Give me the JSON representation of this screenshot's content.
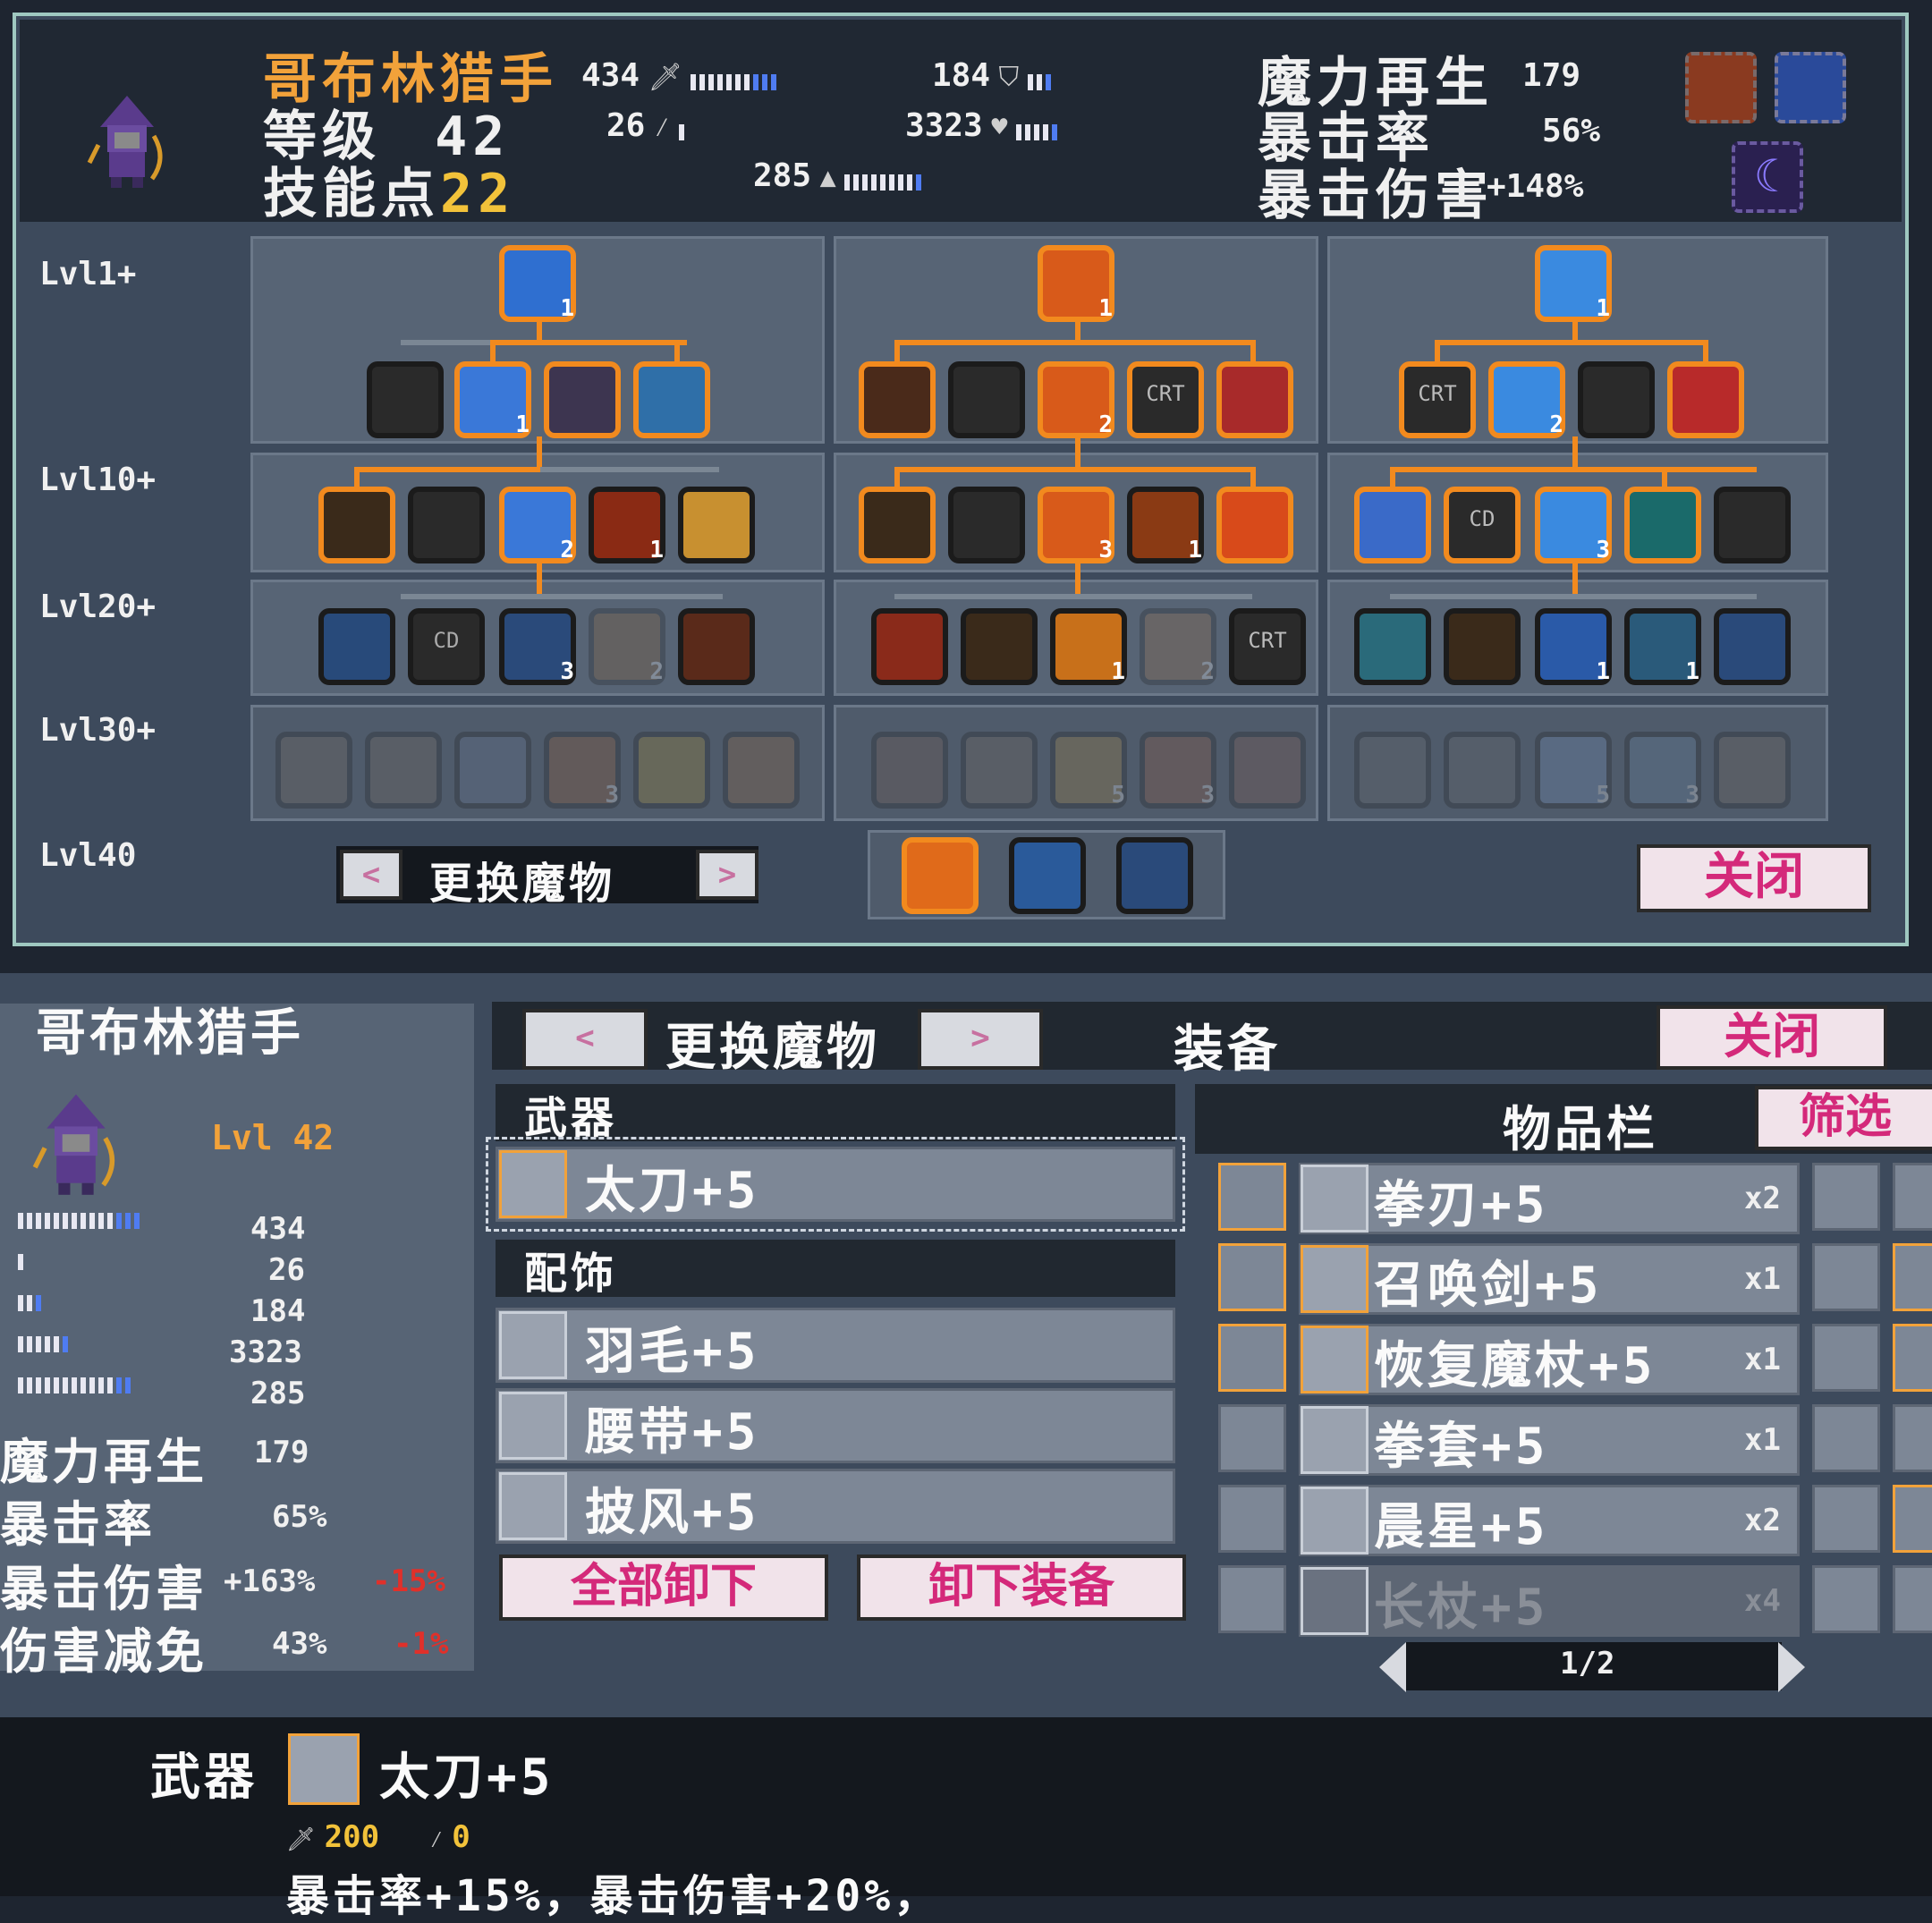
{
  "header": {
    "character_name": "哥布林猎手",
    "level_label": "等级",
    "level_value": "42",
    "skill_points_label": "技能点",
    "skill_points_value": "22",
    "attack": "434",
    "magic": "26",
    "defense": "184",
    "hp": "3323",
    "speed": "285",
    "mana_regen_label": "魔力再生",
    "mana_regen_value": "179",
    "crit_rate_label": "暴击率",
    "crit_rate_value": "56%",
    "crit_dmg_label": "暴击伤害",
    "crit_dmg_value": "+148%"
  },
  "skill_tree": {
    "level_labels": [
      "Lvl1+",
      "Lvl10+",
      "Lvl20+",
      "Lvl30+",
      "Lvl40"
    ],
    "node_counts": {
      "t1_top": "1",
      "t1_r2": "1",
      "t1_r3": "2",
      "t1_r3b": "1",
      "t1_r4a": "3",
      "t1_r4b": "2",
      "t1_r5": "3",
      "t2_top": "1",
      "t2_r2": "2",
      "t2_r3": "3",
      "t2_r3b": "1",
      "t2_r4": "1",
      "t2_r4b": "2",
      "t2_r5a": "5",
      "t2_r5b": "3",
      "t3_top": "1",
      "t3_r2": "2",
      "t3_r3": "3",
      "t3_r4a": "1",
      "t3_r4b": "1",
      "t3_r5a": "5",
      "t3_r5b": "3"
    },
    "crt_label": "CRT",
    "cd_label": "CD",
    "change_monster": "更换魔物",
    "prev_arrow": "<",
    "next_arrow": ">",
    "close": "关闭"
  },
  "equipment": {
    "character_name": "哥布林猎手",
    "level": "Lvl 42",
    "stats": [
      "434",
      "26",
      "184",
      "3323",
      "285"
    ],
    "mana_regen_label": "魔力再生",
    "mana_regen_value": "179",
    "crit_rate_label": "暴击率",
    "crit_rate_value": "65%",
    "crit_dmg_label": "暴击伤害",
    "crit_dmg_value": "+163%",
    "crit_dmg_delta": "-15%",
    "dmg_reduce_label": "伤害减免",
    "dmg_reduce_value": "43%",
    "dmg_reduce_delta": "-1%",
    "change_monster": "更换魔物",
    "prev_arrow": "<",
    "next_arrow": ">",
    "title": "装备",
    "close": "关闭",
    "weapon_header": "武器",
    "weapon_item": "太刀+5",
    "accessory_header": "配饰",
    "accessories": [
      "羽毛+5",
      "腰带+5",
      "披风+5"
    ],
    "unequip_all": "全部卸下",
    "unequip": "卸下装备",
    "inventory_title": "物品栏",
    "filter": "筛选",
    "inventory": [
      {
        "name": "拳刃+5",
        "qty": "x2"
      },
      {
        "name": "召唤剑+5",
        "qty": "x1"
      },
      {
        "name": "恢复魔杖+5",
        "qty": "x1"
      },
      {
        "name": "拳套+5",
        "qty": "x1"
      },
      {
        "name": "晨星+5",
        "qty": "x2"
      },
      {
        "name": "长杖+5",
        "qty": "x4"
      }
    ],
    "page": "1/2"
  },
  "info_bar": {
    "label": "武器",
    "item": "太刀+5",
    "atk_value": "200",
    "mag_value": "0",
    "effect": "暴击率+15%，暴击伤害+20%，"
  },
  "colors": {
    "accent_orange": "#f28a1e",
    "name_orange": "#f2a23a",
    "crit_red": "#e0302a",
    "button_pink_text": "#d4297a"
  }
}
